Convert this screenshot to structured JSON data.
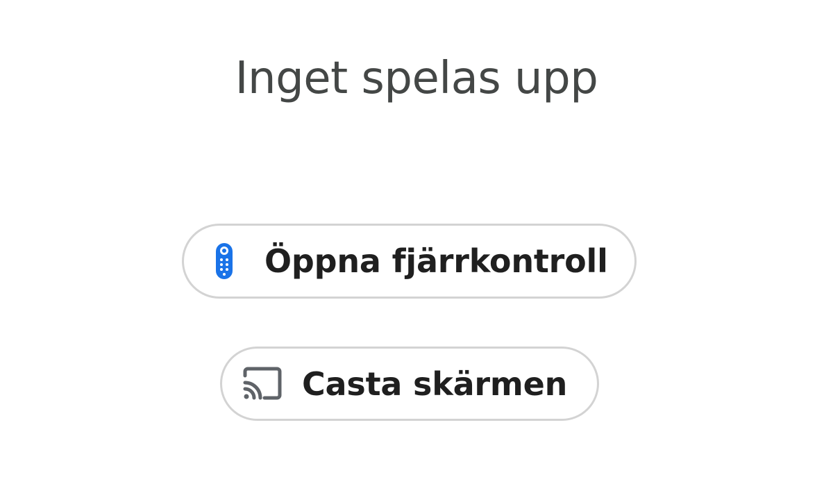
{
  "status": {
    "title": "Inget spelas upp"
  },
  "actions": {
    "remote": {
      "label": "Öppna fjärrkontroll",
      "icon": "remote-control-icon",
      "icon_color": "#1a73e8"
    },
    "cast": {
      "label": "Casta skärmen",
      "icon": "cast-screen-icon",
      "icon_color": "#5f6368"
    }
  },
  "colors": {
    "title_text": "#444746",
    "button_text": "#1f1f1f",
    "button_border": "#d3d3d3",
    "background": "#ffffff"
  }
}
